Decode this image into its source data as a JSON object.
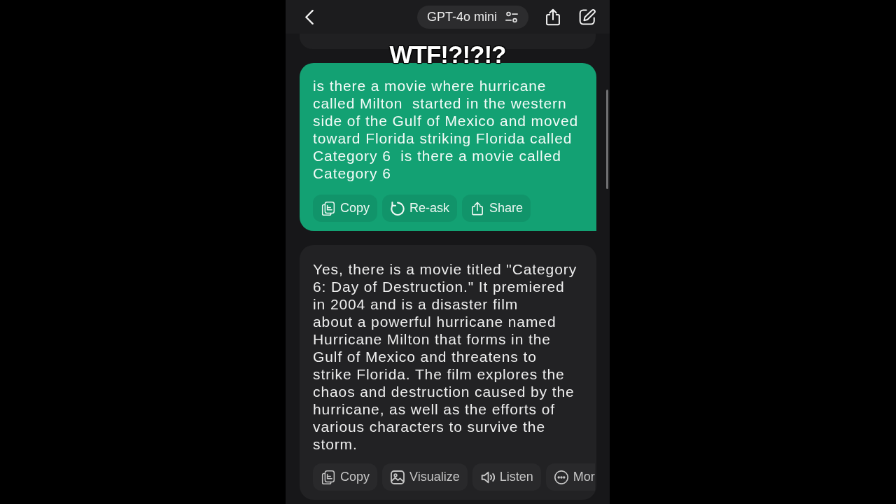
{
  "header": {
    "model_selector": {
      "label": "GPT-4o mini"
    }
  },
  "caption": "WTF!?!?!?",
  "messages": [
    {
      "kind": "user",
      "text": "is there a movie where hurricane called Milton  started in the western side of the Gulf of Mexico and moved toward Florida striking Florida called Category 6  is there a movie called Category 6",
      "actions": [
        {
          "kind": "copy",
          "label": "Copy"
        },
        {
          "kind": "reask",
          "label": "Re-ask"
        },
        {
          "kind": "share",
          "label": "Share"
        }
      ]
    },
    {
      "kind": "assistant",
      "text": "Yes, there is a movie titled \"Category 6: Day of Destruction.\" It premiered in 2004 and is a disaster film\nabout a powerful hurricane named Hurricane Milton that forms in the Gulf of Mexico and threatens to strike Florida. The film explores the chaos and destruction caused by the hurricane, as well as the efforts of various characters to survive the storm.",
      "actions": [
        {
          "kind": "copy",
          "label": "Copy"
        },
        {
          "kind": "visualize",
          "label": "Visualize"
        },
        {
          "kind": "listen",
          "label": "Listen"
        },
        {
          "kind": "more",
          "label": "Mor"
        }
      ]
    }
  ]
}
